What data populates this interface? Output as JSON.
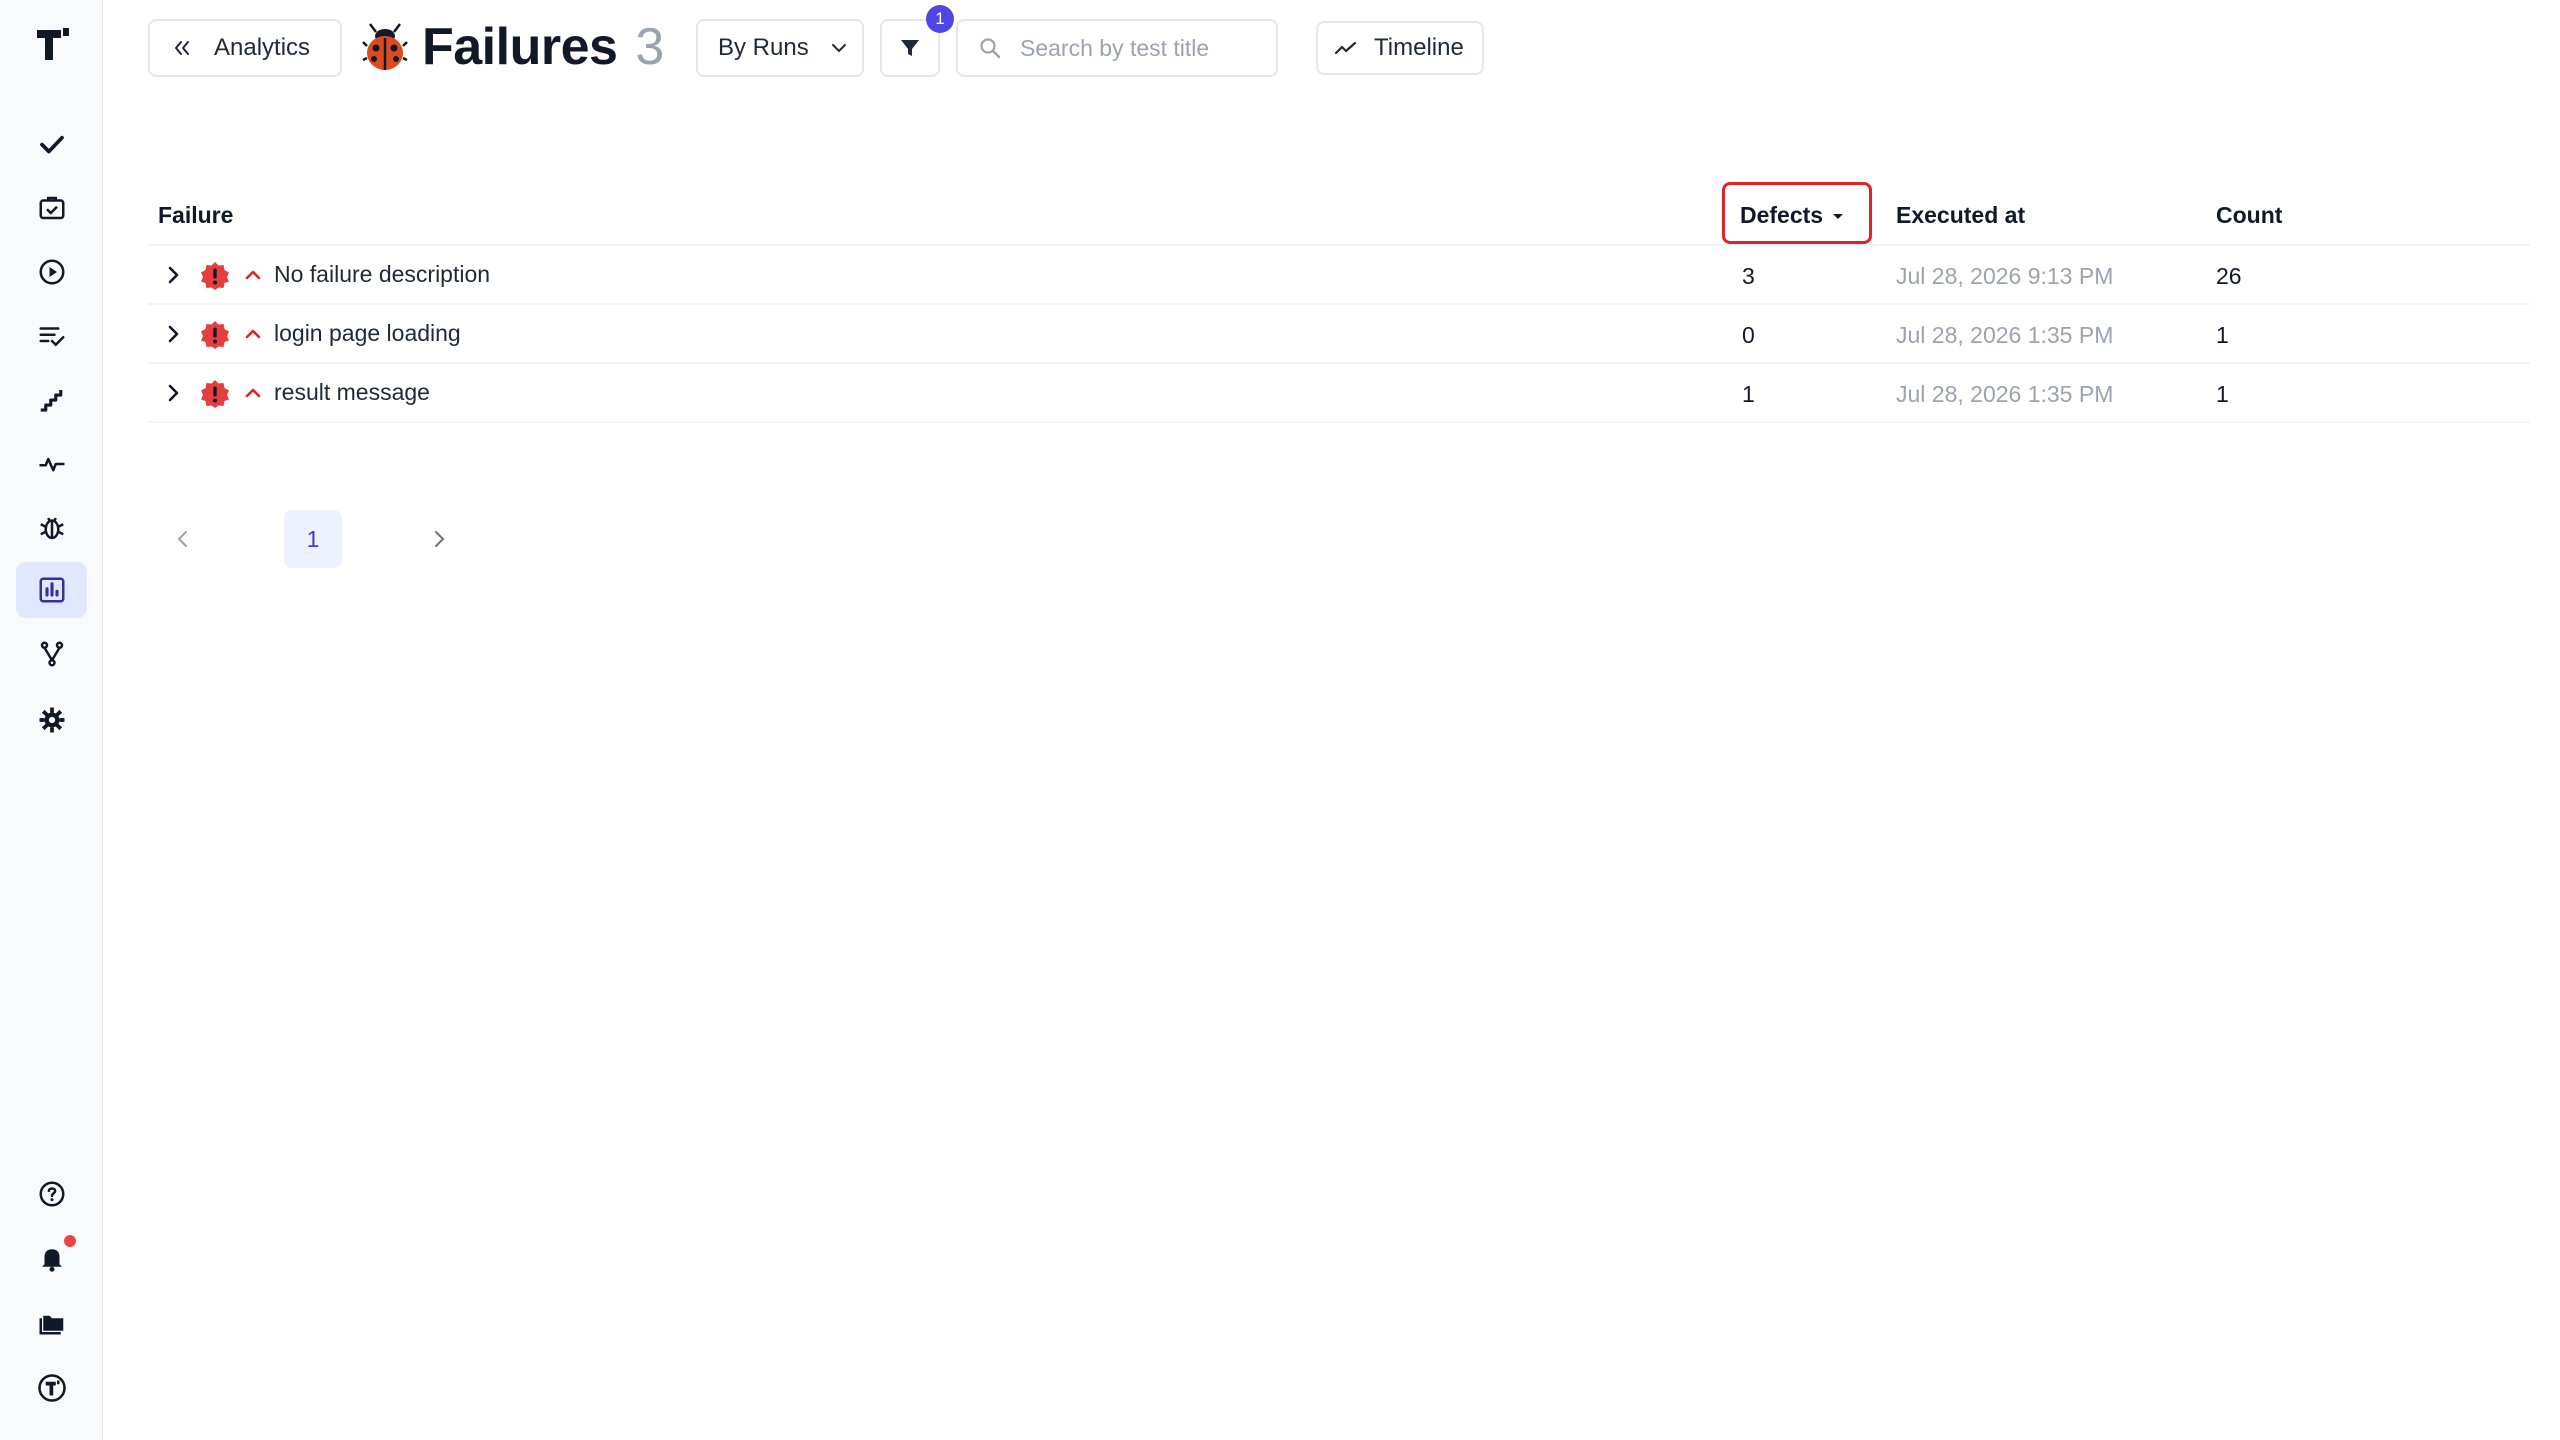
{
  "sidebar": {
    "items": [
      {
        "name": "checkmark-icon"
      },
      {
        "name": "briefcase-check-icon"
      },
      {
        "name": "play-circle-icon"
      },
      {
        "name": "list-check-icon"
      },
      {
        "name": "stairs-icon"
      },
      {
        "name": "pulse-icon"
      },
      {
        "name": "bug-icon"
      },
      {
        "name": "analytics-chart-icon",
        "active": true
      },
      {
        "name": "branch-icon"
      },
      {
        "name": "settings-gear-icon"
      }
    ],
    "bottom_items": [
      {
        "name": "help-icon"
      },
      {
        "name": "bell-icon",
        "has_notification": true
      },
      {
        "name": "folders-icon"
      },
      {
        "name": "account-avatar-icon"
      }
    ]
  },
  "header": {
    "back_label": "Analytics",
    "title": "Failures",
    "count": "3",
    "group_by": "By Runs",
    "filter_count": "1",
    "search_placeholder": "Search by test title",
    "timeline_label": "Timeline"
  },
  "table": {
    "columns": {
      "failure": "Failure",
      "defects": "Defects",
      "executed_at": "Executed at",
      "count": "Count"
    },
    "rows": [
      {
        "name": "No failure description",
        "defects": "3",
        "executed_at": "Jul 28, 2026 9:13 PM",
        "count": "26"
      },
      {
        "name": "login page loading",
        "defects": "0",
        "executed_at": "Jul 28, 2026 1:35 PM",
        "count": "1"
      },
      {
        "name": "result message",
        "defects": "1",
        "executed_at": "Jul 28, 2026 1:35 PM",
        "count": "1"
      }
    ]
  },
  "pagination": {
    "current_page": "1"
  },
  "colors": {
    "accent": "#4f46e5",
    "danger": "#dc2626",
    "muted": "#9ca3af"
  }
}
